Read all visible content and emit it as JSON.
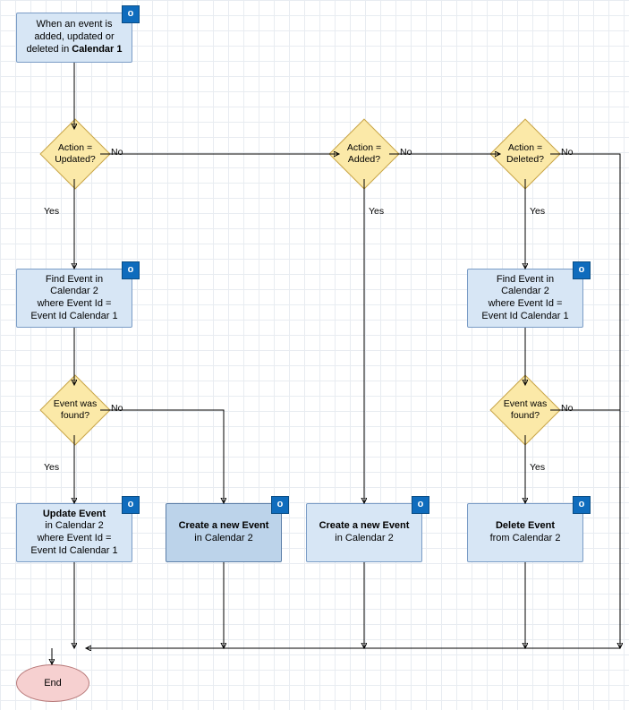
{
  "chart_data": {
    "type": "flowchart",
    "nodes": [
      {
        "id": "start",
        "type": "process",
        "text_html": "When an event is<br>added, updated or<br>deleted in <b>Calendar 1</b>",
        "icon": "outlook-icon"
      },
      {
        "id": "d_upd",
        "type": "decision",
        "text_html": "Action =<br>Updated?"
      },
      {
        "id": "d_add",
        "type": "decision",
        "text_html": "Action =<br>Added?"
      },
      {
        "id": "d_del",
        "type": "decision",
        "text_html": "Action =<br>Deleted?"
      },
      {
        "id": "find1",
        "type": "process",
        "text_html": "Find Event in<br>Calendar 2<br>where Event Id =<br>Event Id Calendar 1",
        "icon": "outlook-icon"
      },
      {
        "id": "find2",
        "type": "process",
        "text_html": "Find Event in<br>Calendar 2<br>where Event Id =<br>Event Id Calendar 1",
        "icon": "outlook-icon"
      },
      {
        "id": "d_found1",
        "type": "decision",
        "text_html": "Event was<br>found?"
      },
      {
        "id": "d_found2",
        "type": "decision",
        "text_html": "Event was<br>found?"
      },
      {
        "id": "upd",
        "type": "process",
        "text_html": "<b>Update Event</b><br>in Calendar 2<br>where Event Id =<br>Event Id Calendar 1",
        "icon": "outlook-icon"
      },
      {
        "id": "create1",
        "type": "process",
        "text_html": "<b>Create a new Event</b><br>in Calendar 2",
        "icon": "outlook-icon"
      },
      {
        "id": "create2",
        "type": "process",
        "text_html": "<b>Create a new Event</b><br>in Calendar 2",
        "icon": "outlook-icon"
      },
      {
        "id": "delete",
        "type": "process",
        "text_html": "<b>Delete Event</b><br>from Calendar 2",
        "icon": "outlook-icon"
      },
      {
        "id": "end",
        "type": "terminator",
        "text_html": "End"
      }
    ],
    "edges": [
      {
        "from": "start",
        "to": "d_upd"
      },
      {
        "from": "d_upd",
        "to": "find1",
        "label": "Yes"
      },
      {
        "from": "d_upd",
        "to": "d_add",
        "label": "No"
      },
      {
        "from": "d_add",
        "to": "create2",
        "label": "Yes"
      },
      {
        "from": "d_add",
        "to": "d_del",
        "label": "No"
      },
      {
        "from": "d_del",
        "to": "find2",
        "label": "Yes"
      },
      {
        "from": "d_del",
        "to": "end",
        "label": "No",
        "route": "right-then-down"
      },
      {
        "from": "find1",
        "to": "d_found1"
      },
      {
        "from": "d_found1",
        "to": "upd",
        "label": "Yes"
      },
      {
        "from": "d_found1",
        "to": "create1",
        "label": "No"
      },
      {
        "from": "find2",
        "to": "d_found2"
      },
      {
        "from": "d_found2",
        "to": "delete",
        "label": "Yes"
      },
      {
        "from": "d_found2",
        "to": "end",
        "label": "No",
        "route": "right-then-down"
      },
      {
        "from": "upd",
        "to": "end"
      },
      {
        "from": "create1",
        "to": "end"
      },
      {
        "from": "create2",
        "to": "end"
      },
      {
        "from": "delete",
        "to": "end"
      }
    ]
  },
  "labels": {
    "yes": "Yes",
    "no": "No",
    "end": "End"
  },
  "icon_glyph": "o⃪"
}
